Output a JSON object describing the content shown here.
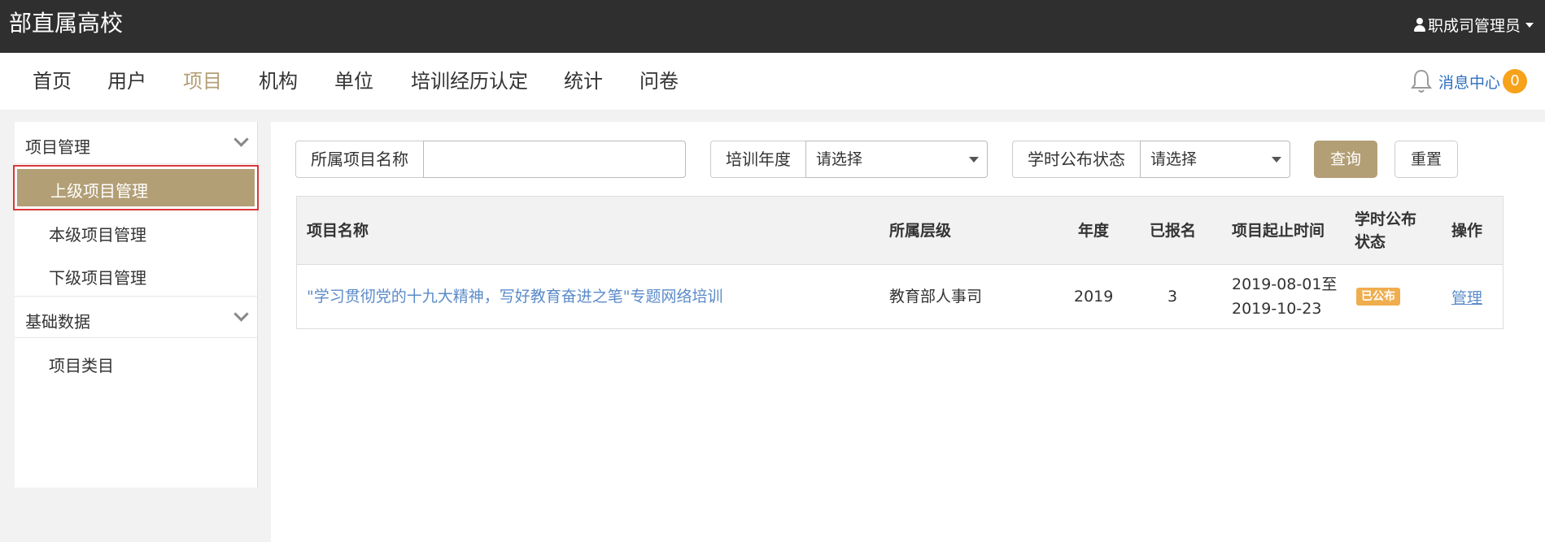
{
  "header": {
    "brand": "部直属高校",
    "user_name": "职成司管理员"
  },
  "nav": {
    "items": [
      "首页",
      "用户",
      "项目",
      "机构",
      "单位",
      "培训经历认定",
      "统计",
      "问卷"
    ],
    "active": "项目",
    "message_center": "消息中心",
    "message_count": "0"
  },
  "sidebar": {
    "groups": [
      {
        "title": "项目管理",
        "items": [
          "上级项目管理",
          "本级项目管理",
          "下级项目管理"
        ]
      },
      {
        "title": "基础数据",
        "items": [
          "项目类目"
        ]
      }
    ],
    "active_item": "上级项目管理"
  },
  "filters": {
    "project_name_label": "所属项目名称",
    "project_name_value": "",
    "year_label": "培训年度",
    "year_value": "请选择",
    "status_label": "学时公布状态",
    "status_value": "请选择",
    "query_button": "查询",
    "reset_button": "重置"
  },
  "table": {
    "columns": [
      "项目名称",
      "所属层级",
      "年度",
      "已报名",
      "项目起止时间",
      "学时公布",
      "状态",
      "操作"
    ],
    "rows": [
      {
        "name": "\"学习贯彻党的十九大精神，写好教育奋进之笔\"专题网络培训",
        "level": "教育部人事司",
        "year": "2019",
        "enrolled": "3",
        "start": "2019-08-01至",
        "end": "2019-10-23",
        "status": "已公布",
        "action": "管理"
      }
    ]
  },
  "colors": {
    "accent": "#b39f76",
    "topbar": "#2f2f2f",
    "badge": "#f6a21b",
    "link": "#5b8bc9",
    "highlight_border": "#d9393a"
  }
}
